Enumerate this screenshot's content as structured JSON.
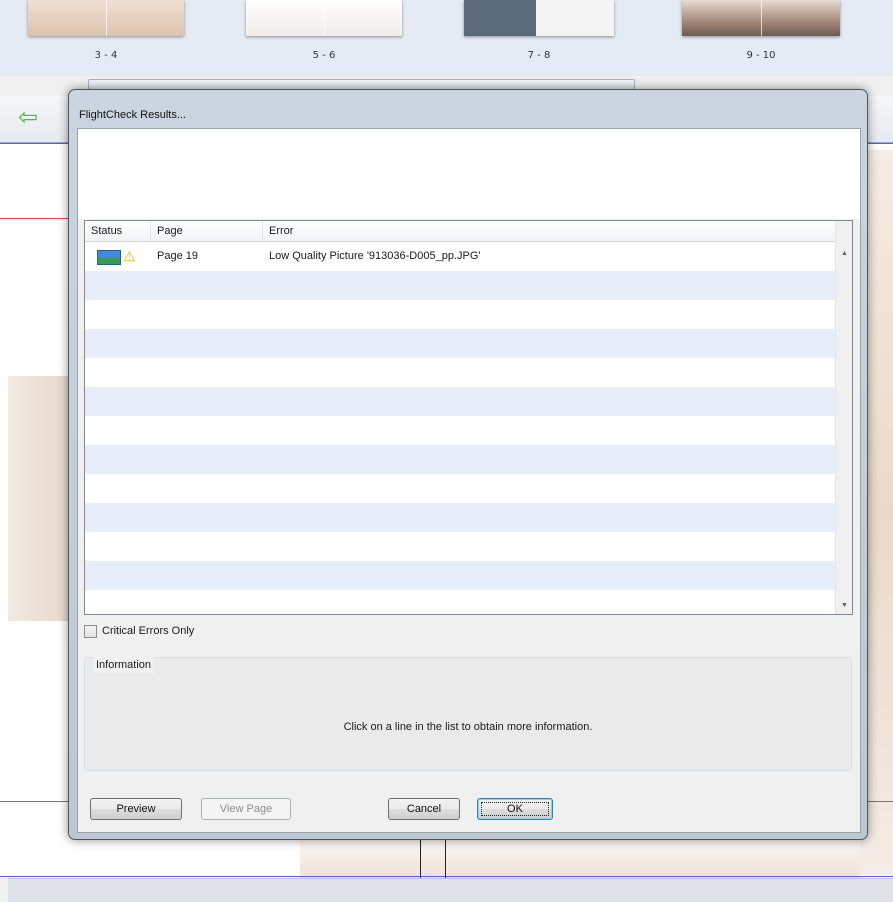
{
  "background_app": {
    "thumbnails": [
      {
        "label": "3 - 4"
      },
      {
        "label": "5 - 6"
      },
      {
        "label": "7 - 8"
      },
      {
        "label": "9 - 10"
      }
    ],
    "nav_icon": "arrow-left-icon"
  },
  "dialog": {
    "title": "FlightCheck Results...",
    "columns": {
      "status": "Status",
      "page": "Page",
      "error": "Error"
    },
    "rows": [
      {
        "status_icons": [
          "picture-icon",
          "warning-icon"
        ],
        "page": "Page 19",
        "error": "Low Quality Picture '913036-D005_pp.JPG'"
      }
    ],
    "critical_only": {
      "label": "Critical Errors Only",
      "checked": false
    },
    "information": {
      "legend": "Information",
      "text": "Click on a line in the list to obtain more information."
    },
    "buttons": {
      "preview": "Preview",
      "view_page": "View Page",
      "cancel": "Cancel",
      "ok": "OK"
    }
  },
  "colors": {
    "row_alt": "#e7eefa",
    "warning": "#f2b600",
    "guide_red": "#e44a4a",
    "guide_blue": "#5a5ae6"
  }
}
